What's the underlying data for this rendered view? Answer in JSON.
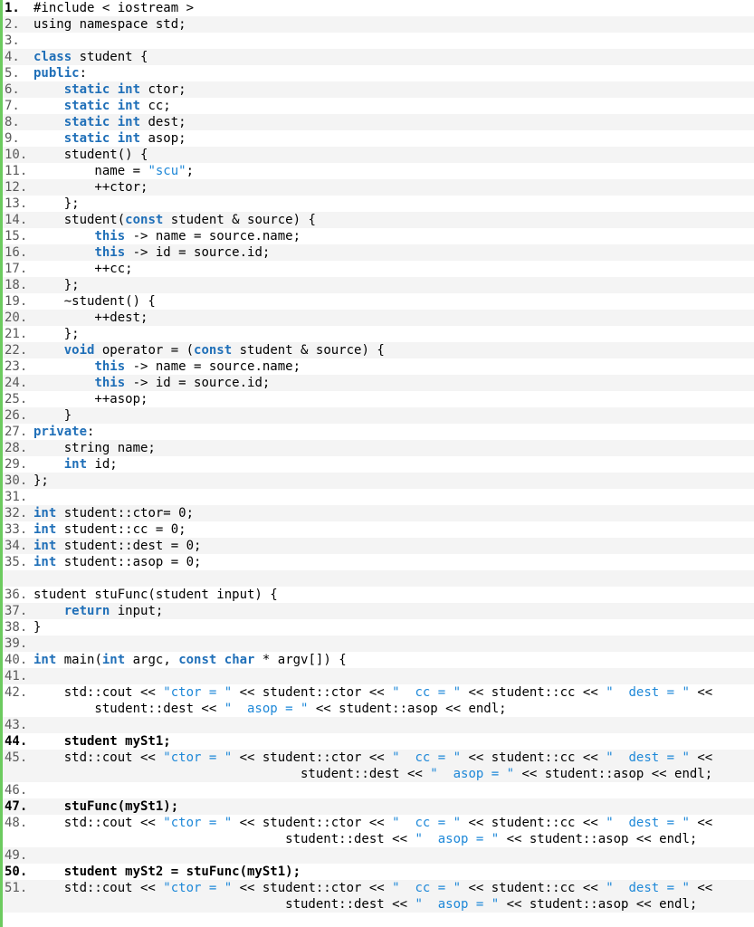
{
  "code_view": {
    "lines": [
      {
        "n": "1.",
        "segs": [
          [
            "t",
            "#include < iostream >"
          ]
        ]
      },
      {
        "n": "2.",
        "segs": [
          [
            "t",
            "using namespace std;"
          ]
        ]
      },
      {
        "n": "3.",
        "segs": []
      },
      {
        "n": "4.",
        "segs": [
          [
            "k",
            "class"
          ],
          [
            "t",
            " student {"
          ]
        ]
      },
      {
        "n": "5.",
        "segs": [
          [
            "k",
            "public"
          ],
          [
            "t",
            ":"
          ]
        ]
      },
      {
        "n": "6.",
        "segs": [
          [
            "t",
            "    "
          ],
          [
            "k",
            "static int"
          ],
          [
            "t",
            " ctor;"
          ]
        ]
      },
      {
        "n": "7.",
        "segs": [
          [
            "t",
            "    "
          ],
          [
            "k",
            "static int"
          ],
          [
            "t",
            " cc;"
          ]
        ]
      },
      {
        "n": "8.",
        "segs": [
          [
            "t",
            "    "
          ],
          [
            "k",
            "static int"
          ],
          [
            "t",
            " dest;"
          ]
        ]
      },
      {
        "n": "9.",
        "segs": [
          [
            "t",
            "    "
          ],
          [
            "k",
            "static int"
          ],
          [
            "t",
            " asop;"
          ]
        ]
      },
      {
        "n": "10.",
        "segs": [
          [
            "t",
            "    student() {"
          ]
        ]
      },
      {
        "n": "11.",
        "segs": [
          [
            "t",
            "        name = "
          ],
          [
            "s",
            "\"scu\""
          ],
          [
            "t",
            ";"
          ]
        ]
      },
      {
        "n": "12.",
        "segs": [
          [
            "t",
            "        ++ctor;"
          ]
        ]
      },
      {
        "n": "13.",
        "segs": [
          [
            "t",
            "    };"
          ]
        ]
      },
      {
        "n": "14.",
        "segs": [
          [
            "t",
            "    student("
          ],
          [
            "k",
            "const"
          ],
          [
            "t",
            " student & source) {"
          ]
        ]
      },
      {
        "n": "15.",
        "segs": [
          [
            "t",
            "        "
          ],
          [
            "k",
            "this"
          ],
          [
            "t",
            " -> name = source.name;"
          ]
        ]
      },
      {
        "n": "16.",
        "segs": [
          [
            "t",
            "        "
          ],
          [
            "k",
            "this"
          ],
          [
            "t",
            " -> id = source.id;"
          ]
        ]
      },
      {
        "n": "17.",
        "segs": [
          [
            "t",
            "        ++cc;"
          ]
        ]
      },
      {
        "n": "18.",
        "segs": [
          [
            "t",
            "    };"
          ]
        ]
      },
      {
        "n": "19.",
        "segs": [
          [
            "t",
            "    ~student() {"
          ]
        ]
      },
      {
        "n": "20.",
        "segs": [
          [
            "t",
            "        ++dest;"
          ]
        ]
      },
      {
        "n": "21.",
        "segs": [
          [
            "t",
            "    };"
          ]
        ]
      },
      {
        "n": "22.",
        "segs": [
          [
            "t",
            "    "
          ],
          [
            "k",
            "void"
          ],
          [
            "t",
            " operator = ("
          ],
          [
            "k",
            "const"
          ],
          [
            "t",
            " student & source) {"
          ]
        ]
      },
      {
        "n": "23.",
        "segs": [
          [
            "t",
            "        "
          ],
          [
            "k",
            "this"
          ],
          [
            "t",
            " -> name = source.name;"
          ]
        ]
      },
      {
        "n": "24.",
        "segs": [
          [
            "t",
            "        "
          ],
          [
            "k",
            "this"
          ],
          [
            "t",
            " -> id = source.id;"
          ]
        ]
      },
      {
        "n": "25.",
        "segs": [
          [
            "t",
            "        ++asop;"
          ]
        ]
      },
      {
        "n": "26.",
        "segs": [
          [
            "t",
            "    }"
          ]
        ]
      },
      {
        "n": "27.",
        "segs": [
          [
            "k",
            "private"
          ],
          [
            "t",
            ":"
          ]
        ]
      },
      {
        "n": "28.",
        "segs": [
          [
            "t",
            "    string name;"
          ]
        ]
      },
      {
        "n": "29.",
        "segs": [
          [
            "t",
            "    "
          ],
          [
            "k",
            "int"
          ],
          [
            "t",
            " id;"
          ]
        ]
      },
      {
        "n": "30.",
        "segs": [
          [
            "t",
            "};"
          ]
        ]
      },
      {
        "n": "31.",
        "segs": []
      },
      {
        "n": "32.",
        "segs": [
          [
            "k",
            "int"
          ],
          [
            "t",
            " student::ctor= 0;"
          ]
        ]
      },
      {
        "n": "33.",
        "segs": [
          [
            "k",
            "int"
          ],
          [
            "t",
            " student::cc = 0;"
          ]
        ]
      },
      {
        "n": "34.",
        "segs": [
          [
            "k",
            "int"
          ],
          [
            "t",
            " student::dest = 0;"
          ]
        ]
      },
      {
        "n": "35.",
        "segs": [
          [
            "k",
            "int"
          ],
          [
            "t",
            " student::asop = 0;"
          ]
        ]
      },
      {
        "n": "",
        "segs": []
      },
      {
        "n": "36.",
        "segs": [
          [
            "t",
            "student stuFunc(student input) {"
          ]
        ]
      },
      {
        "n": "37.",
        "segs": [
          [
            "t",
            "    "
          ],
          [
            "k",
            "return"
          ],
          [
            "t",
            " input;"
          ]
        ]
      },
      {
        "n": "38.",
        "segs": [
          [
            "t",
            "}"
          ]
        ]
      },
      {
        "n": "39.",
        "segs": []
      },
      {
        "n": "40.",
        "segs": [
          [
            "k",
            "int"
          ],
          [
            "t",
            " main("
          ],
          [
            "k",
            "int"
          ],
          [
            "t",
            " argc, "
          ],
          [
            "k",
            "const char"
          ],
          [
            "t",
            " * argv[]) {"
          ]
        ]
      },
      {
        "n": "41.",
        "segs": []
      },
      {
        "n": "42.",
        "segs": [
          [
            "t",
            "    std::cout << "
          ],
          [
            "s",
            "\"ctor = \""
          ],
          [
            "t",
            " << student::ctor << "
          ],
          [
            "s",
            "\"  cc = \""
          ],
          [
            "t",
            " << student::cc << "
          ],
          [
            "s",
            "\"  dest = \""
          ],
          [
            "t",
            " <<\n        student::dest << "
          ],
          [
            "s",
            "\"  asop = \""
          ],
          [
            "t",
            " << student::asop << endl;"
          ]
        ]
      },
      {
        "n": "43.",
        "segs": []
      },
      {
        "n": "44.",
        "bold_n": true,
        "segs": [
          [
            "b",
            "    student mySt1;"
          ]
        ]
      },
      {
        "n": "45.",
        "segs": [
          [
            "t",
            "    std::cout << "
          ],
          [
            "s",
            "\"ctor = \""
          ],
          [
            "t",
            " << student::ctor << "
          ],
          [
            "s",
            "\"  cc = \""
          ],
          [
            "t",
            " << student::cc << "
          ],
          [
            "s",
            "\"  dest = \""
          ],
          [
            "t",
            " <<\n                                   student::dest << "
          ],
          [
            "s",
            "\"  asop = \""
          ],
          [
            "t",
            " << student::asop << endl;"
          ]
        ]
      },
      {
        "n": "46.",
        "segs": []
      },
      {
        "n": "47.",
        "bold_n": true,
        "segs": [
          [
            "b",
            "    stuFunc(mySt1);"
          ]
        ]
      },
      {
        "n": "48.",
        "segs": [
          [
            "t",
            "    std::cout << "
          ],
          [
            "s",
            "\"ctor = \""
          ],
          [
            "t",
            " << student::ctor << "
          ],
          [
            "s",
            "\"  cc = \""
          ],
          [
            "t",
            " << student::cc << "
          ],
          [
            "s",
            "\"  dest = \""
          ],
          [
            "t",
            " <<\n                                 student::dest << "
          ],
          [
            "s",
            "\"  asop = \""
          ],
          [
            "t",
            " << student::asop << endl;"
          ]
        ]
      },
      {
        "n": "49.",
        "segs": []
      },
      {
        "n": "50.",
        "bold_n": true,
        "segs": [
          [
            "b",
            "    student mySt2 = stuFunc(mySt1);"
          ]
        ]
      },
      {
        "n": "51.",
        "segs": [
          [
            "t",
            "    std::cout << "
          ],
          [
            "s",
            "\"ctor = \""
          ],
          [
            "t",
            " << student::ctor << "
          ],
          [
            "s",
            "\"  cc = \""
          ],
          [
            "t",
            " << student::cc << "
          ],
          [
            "s",
            "\"  dest = \""
          ],
          [
            "t",
            " <<\n                                 student::dest << "
          ],
          [
            "s",
            "\"  asop = \""
          ],
          [
            "t",
            " << student::asop << endl;"
          ]
        ]
      }
    ],
    "colors": {
      "keyword": "#1f6fb8",
      "string": "#1e88d8",
      "gutter_bar": "#6ccb5f",
      "alt_row": "#f4f4f4"
    }
  }
}
